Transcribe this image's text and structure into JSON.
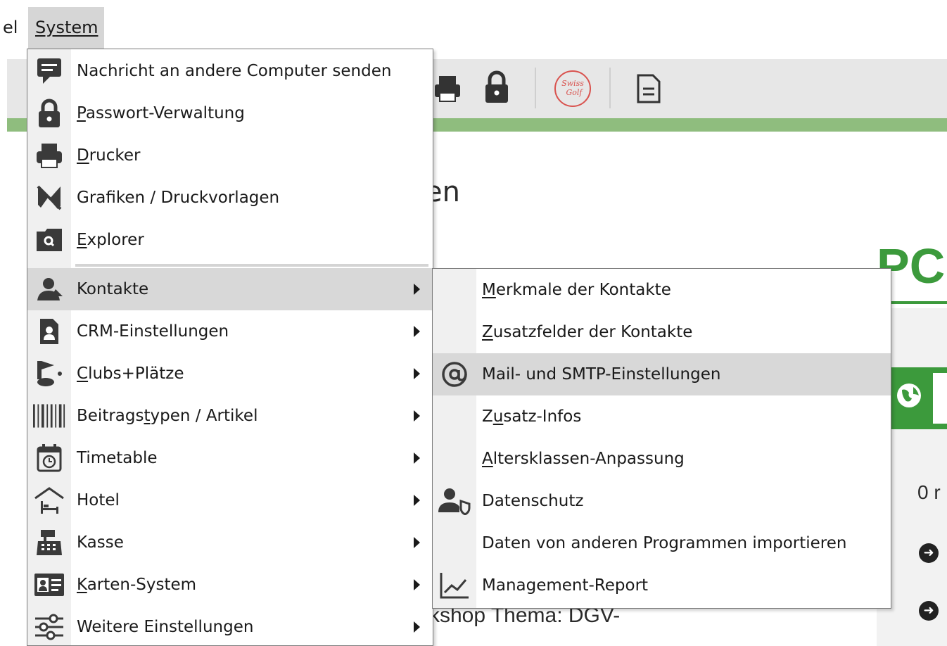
{
  "menubar": {
    "prev_label": "el",
    "system_label": "System"
  },
  "background": {
    "heading_fragment": "en",
    "footer_fragment": "kshop Thema: DGV-",
    "right_fragment": "0 r",
    "big_green_text": "PC",
    "toolbar_icons": [
      "printer-icon",
      "lock-icon",
      "swiss-golf-logo",
      "document-icon"
    ],
    "swiss_golf_logo_text": "Swiss Golf"
  },
  "system_menu": {
    "items": [
      {
        "label": "Nachricht an andere Computer senden",
        "icon": "message-icon",
        "submenu": false
      },
      {
        "label_pre": "",
        "label_u": "P",
        "label_post": "asswort-Verwaltung",
        "icon": "lock-icon",
        "submenu": false
      },
      {
        "label_pre": "",
        "label_u": "D",
        "label_post": "rucker",
        "icon": "printer-icon",
        "submenu": false
      },
      {
        "label": "Grafiken / Druckvorlagen",
        "icon": "graphics-icon",
        "submenu": false
      },
      {
        "label_pre": "",
        "label_u": "E",
        "label_post": "xplorer",
        "icon": "explorer-icon",
        "submenu": false
      },
      {
        "label": "Kontakte",
        "icon": "contacts-icon",
        "submenu": true
      },
      {
        "label": "CRM-Einstellungen",
        "icon": "crm-icon",
        "submenu": true
      },
      {
        "label_pre": "",
        "label_u": "C",
        "label_post": "lubs+Plätze",
        "icon": "golf-flag-icon",
        "submenu": true
      },
      {
        "label_pre": "Beitrags",
        "label_u": "t",
        "label_post": "ypen / Artikel",
        "icon": "barcode-icon",
        "submenu": true
      },
      {
        "label": "Timetable",
        "icon": "calendar-clock-icon",
        "submenu": true
      },
      {
        "label": "Hotel",
        "icon": "hotel-icon",
        "submenu": true
      },
      {
        "label": "Kasse",
        "icon": "cash-register-icon",
        "submenu": true
      },
      {
        "label_pre": "",
        "label_u": "K",
        "label_post": "arten-System",
        "icon": "id-card-icon",
        "submenu": true
      },
      {
        "label": "Weitere Einstellungen",
        "icon": "sliders-icon",
        "submenu": true
      }
    ]
  },
  "kontakte_submenu": {
    "items": [
      {
        "label_pre": "",
        "label_u": "M",
        "label_post": "erkmale der Kontakte",
        "icon": ""
      },
      {
        "label_pre": "",
        "label_u": "Z",
        "label_post": "usatzfelder der Kontakte",
        "icon": ""
      },
      {
        "label": "Mail- und SMTP-Einstellungen",
        "icon": "at-icon"
      },
      {
        "label_pre": "Z",
        "label_u": "u",
        "label_post": "satz-Infos",
        "icon": ""
      },
      {
        "label_pre": "",
        "label_u": "A",
        "label_post": "ltersklassen-Anpassung",
        "icon": ""
      },
      {
        "label": "Datenschutz",
        "icon": "privacy-user-icon"
      },
      {
        "label": "Daten von anderen Programmen importieren",
        "icon": ""
      },
      {
        "label": "Management-Report",
        "icon": "chart-line-icon"
      }
    ]
  },
  "colors": {
    "menu_highlight": "#d8d8d8",
    "gutter": "#f0f0f0",
    "accent_green": "#3c9a3c",
    "toolbar_green_line": "#8fbd7e"
  }
}
